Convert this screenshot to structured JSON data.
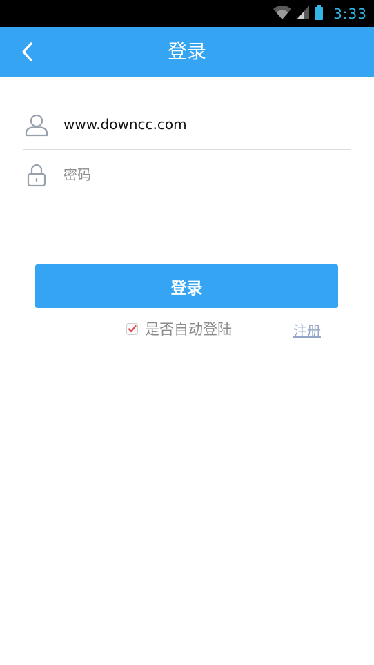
{
  "status_bar": {
    "time": "3:33",
    "icons": [
      "wifi-icon",
      "signal-icon",
      "battery-icon"
    ],
    "time_color": "#33b5e5"
  },
  "header": {
    "title": "登录",
    "back_icon": "chevron-left-icon",
    "background": "#35a5f3"
  },
  "form": {
    "username": {
      "icon": "user-icon",
      "value": "www.downcc.com",
      "placeholder": ""
    },
    "password": {
      "icon": "lock-icon",
      "value": "",
      "placeholder": "密码"
    },
    "login_label": "登录",
    "auto_login": {
      "label": "是否自动登陆",
      "checked": true
    },
    "register_label": "注册"
  },
  "colors": {
    "accent": "#35a5f3",
    "link": "#94a6c8",
    "check": "#e04040"
  }
}
